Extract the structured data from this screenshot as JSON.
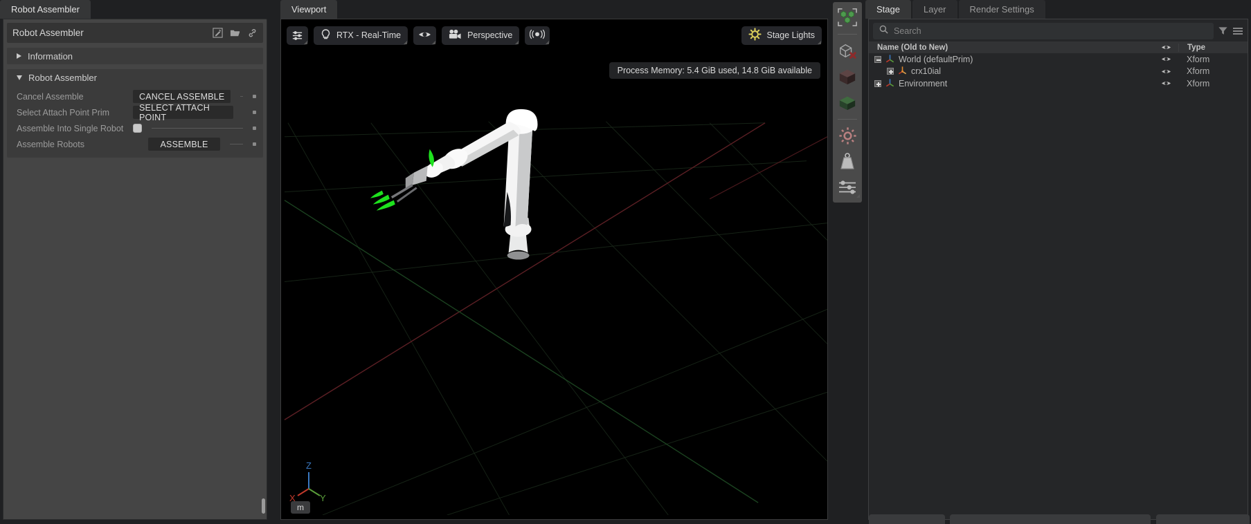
{
  "left_panel": {
    "tab": "Robot Assembler",
    "header_title": "Robot Assembler",
    "header_icons": [
      "edit-icon",
      "open-folder-icon",
      "link-icon"
    ],
    "sections": [
      {
        "title": "Information",
        "expanded": false,
        "rows": []
      },
      {
        "title": "Robot Assembler",
        "expanded": true,
        "rows": [
          {
            "label": "Cancel Assemble",
            "control": "button",
            "value": "CANCEL ASSEMBLE"
          },
          {
            "label": "Select Attach Point Prim",
            "control": "button",
            "value": "SELECT ATTACH POINT"
          },
          {
            "label": "Assemble Into Single Robot",
            "control": "checkbox",
            "value": "checked"
          },
          {
            "label": "Assemble Robots",
            "control": "button-centered",
            "value": "ASSEMBLE"
          }
        ]
      }
    ]
  },
  "viewport": {
    "tab": "Viewport",
    "toolbar": [
      {
        "name": "viewport-settings-button",
        "icon": "sliders-icon",
        "label": ""
      },
      {
        "name": "render-mode-button",
        "icon": "lightbulb-icon",
        "label": "RTX - Real-Time"
      },
      {
        "name": "visibility-button",
        "icon": "eye-icon",
        "label": ""
      },
      {
        "name": "camera-button",
        "icon": "camera-icon",
        "label": "Perspective"
      },
      {
        "name": "sensors-button",
        "icon": "signal-icon",
        "label": ""
      }
    ],
    "stage_lights_button": {
      "label": "Stage Lights",
      "icon": "sun-icon",
      "color": "#d9cd5a"
    },
    "memory_tooltip": "Process Memory: 5.4 GiB used, 14.8 GiB available",
    "gizmo": {
      "x": "X",
      "y": "Y",
      "z": "Z",
      "x_color": "#c0392b",
      "y_color": "#5a9e3a",
      "z_color": "#3a78c0"
    },
    "unit": "m",
    "scene": {
      "robot": "crx10ial",
      "grid_color": "#1d2d1d",
      "axis_red": "#5c1e22",
      "axis_green": "#1e4a22"
    }
  },
  "rail": {
    "buttons": [
      {
        "name": "select-multiple-icon",
        "label": "Select"
      },
      {
        "name": "delete-prim-icon",
        "label": "Delete"
      },
      {
        "name": "dark-cube-icon",
        "label": "Physics Material"
      },
      {
        "name": "green-cube-icon",
        "label": "Collider"
      },
      {
        "name": "settings-gear-icon",
        "label": "Settings"
      },
      {
        "name": "mass-weight-icon",
        "label": "Mass"
      },
      {
        "name": "sliders-icon",
        "label": "Properties"
      }
    ]
  },
  "right_panel": {
    "tabs": [
      {
        "label": "Stage",
        "active": true
      },
      {
        "label": "Layer",
        "active": false
      },
      {
        "label": "Render Settings",
        "active": false
      }
    ],
    "search": {
      "placeholder": "Search",
      "value": ""
    },
    "search_icons": [
      "filter-icon",
      "menu-icon"
    ],
    "columns": {
      "name": "Name (Old to New)",
      "eye": "eye-icon",
      "type": "Type"
    },
    "rows": [
      {
        "indent": 0,
        "expander": "minus",
        "icon": "xform-axis-icon",
        "name": "World (defaultPrim)",
        "visible": true,
        "type": "Xform"
      },
      {
        "indent": 1,
        "expander": "plus",
        "icon": "robot-axis-icon",
        "name": "crx10ial",
        "visible": true,
        "type": "Xform"
      },
      {
        "indent": 0,
        "expander": "plus",
        "icon": "xform-axis-icon",
        "name": "Environment",
        "visible": true,
        "type": "Xform"
      }
    ]
  }
}
